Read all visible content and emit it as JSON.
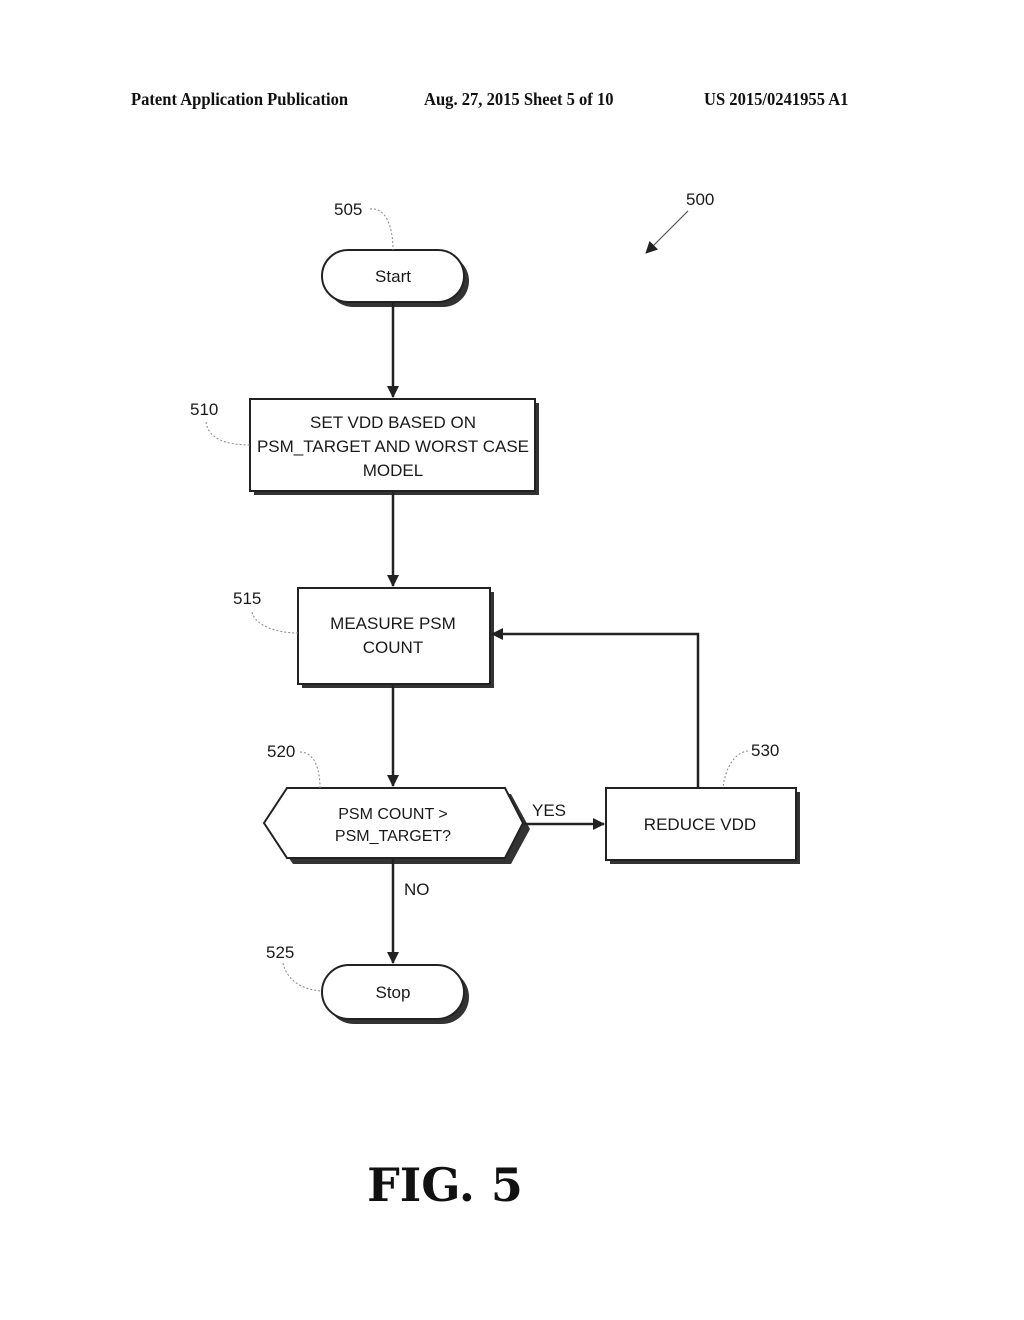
{
  "header": {
    "publication": "Patent Application Publication",
    "date_sheet": "Aug. 27, 2015  Sheet 5 of 10",
    "patent_number": "US 2015/0241955 A1"
  },
  "figure": {
    "label": "FIG. 5",
    "reference": "500"
  },
  "nodes": {
    "start": {
      "ref": "505",
      "text": "Start",
      "shape": "terminator"
    },
    "set_vdd": {
      "ref": "510",
      "lines": [
        "SET VDD BASED ON",
        "PSM_TARGET AND WORST CASE",
        "MODEL"
      ],
      "shape": "process"
    },
    "measure": {
      "ref": "515",
      "lines": [
        "MEASURE PSM",
        "COUNT"
      ],
      "shape": "process"
    },
    "decision": {
      "ref": "520",
      "lines": [
        "PSM COUNT >",
        "PSM_TARGET?"
      ],
      "shape": "decision"
    },
    "stop": {
      "ref": "525",
      "text": "Stop",
      "shape": "terminator"
    },
    "reduce": {
      "ref": "530",
      "text": "REDUCE VDD",
      "shape": "process"
    }
  },
  "edges": {
    "yes_label": "YES",
    "no_label": "NO"
  }
}
